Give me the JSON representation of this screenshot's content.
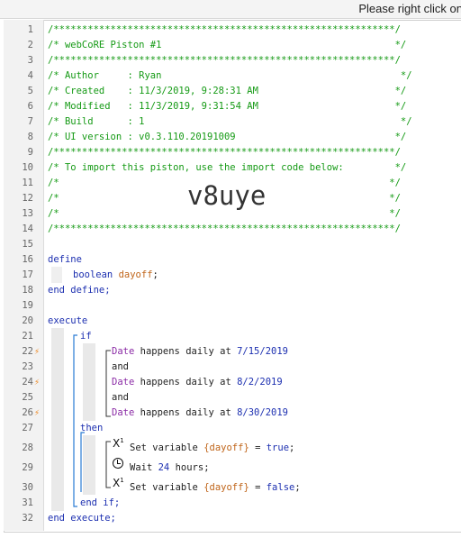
{
  "topbar": {
    "hint": "Please right click on"
  },
  "line_numbers": [
    "1",
    "2",
    "3",
    "4",
    "5",
    "6",
    "7",
    "8",
    "9",
    "10",
    "11",
    "12",
    "13",
    "14",
    "15",
    "16",
    "17",
    "18",
    "19",
    "20",
    "21",
    "22",
    "23",
    "24",
    "25",
    "26",
    "27",
    "28",
    "29",
    "30",
    "31",
    "32"
  ],
  "header": {
    "border": "/************************************************************/",
    "title": "/* webCoRE Piston #1                                         */",
    "author": "/* Author     : Ryan                                          */",
    "created": "/* Created    : 11/3/2019, 9:28:31 AM                        */",
    "modified": "/* Modified   : 11/3/2019, 9:31:54 AM                        */",
    "build": "/* Build      : 1                                             */",
    "ui_version": "/* UI version : v0.3.110.20191009                            */",
    "import_note": "/* To import this piston, use the import code below:         */",
    "blank_comment": "/*                                                          */",
    "import_code": "v8uye"
  },
  "code": {
    "define": "define",
    "boolean": "boolean",
    "dayoff_var": "dayoff",
    "semicolon": ";",
    "end_define": "end define;",
    "execute": "execute",
    "if": "if",
    "date": "Date",
    "happens_daily_at": " happens daily at ",
    "date1": "7/15/2019",
    "date2": "8/2/2019",
    "date3": "8/30/2019",
    "and": "and",
    "then": "then",
    "set_variable": "Set variable ",
    "var_ref": "{dayoff}",
    "equals": " = ",
    "true_val": "true",
    "false_val": "false",
    "wait": "Wait ",
    "wait_amount": "24",
    "wait_unit": " hours;",
    "end_if": "end if;",
    "end_execute": "end execute;",
    "x_icon": "X",
    "x_sup": "1"
  }
}
